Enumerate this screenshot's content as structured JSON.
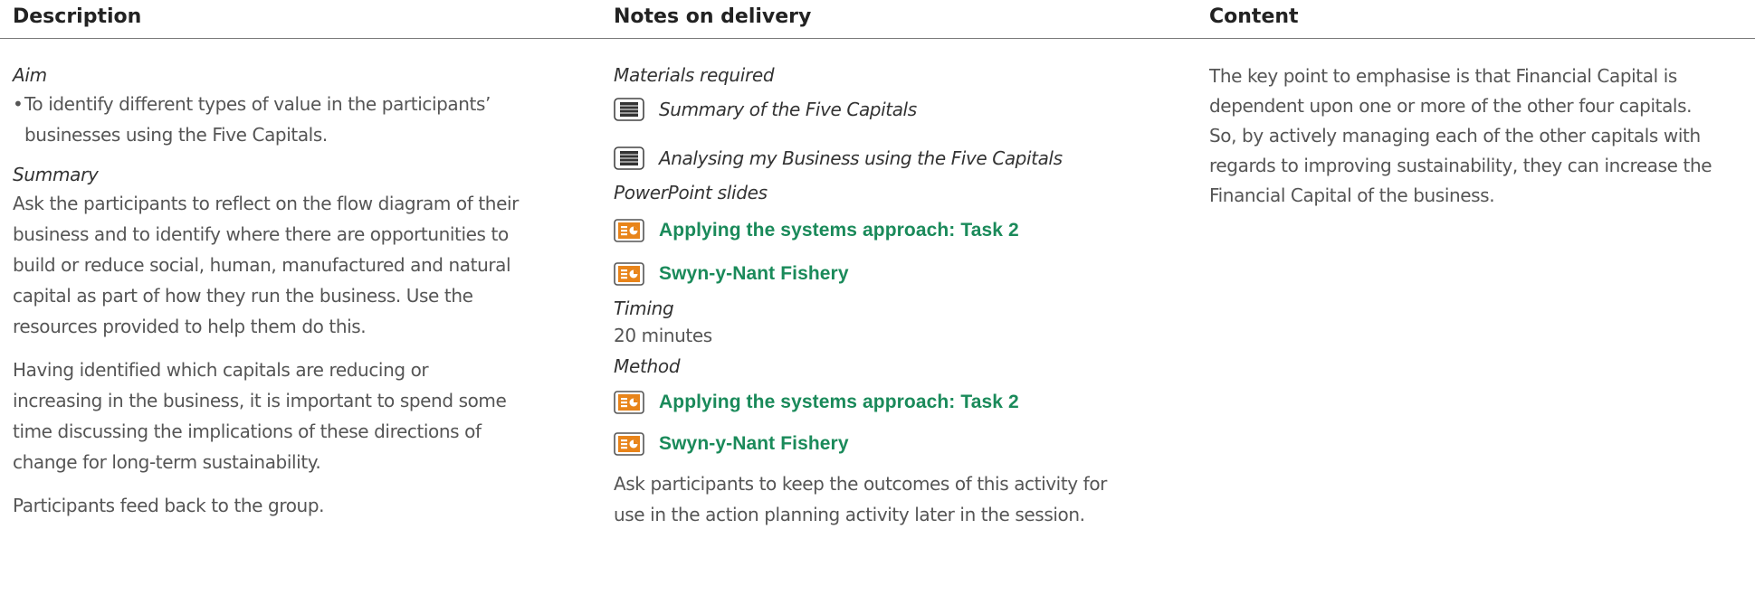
{
  "header": {
    "description": "Description",
    "notes": "Notes on delivery",
    "content": "Content"
  },
  "description": {
    "aim_label": "Aim",
    "aim_bullet_line1": "To identify different types of value in the participants’",
    "aim_bullet_line2": "businesses using the Five Capitals.",
    "summary_label": "Summary",
    "summary_p1": [
      "Ask the participants to reflect on the flow diagram of their",
      "business and to identify where there are opportunities to",
      "build or reduce social, human, manufactured and natural",
      "capital as part of how they run the business. Use the",
      "resources provided to help them do this."
    ],
    "summary_p2": [
      "Having identified which capitals are reducing or",
      "increasing in the business, it is important to spend some",
      "time discussing the implications of these directions of",
      "change for long-term sustainability."
    ],
    "summary_p3": "Participants feed back to the group."
  },
  "notes": {
    "materials_label": "Materials required",
    "materials": [
      {
        "icon": "document-icon",
        "title": "Summary of the Five Capitals"
      },
      {
        "icon": "document-icon",
        "title": "Analysing my Business using the Five Capitals"
      }
    ],
    "ppt_label": "PowerPoint slides",
    "ppt_slides": [
      {
        "icon": "powerpoint-icon",
        "title": "Applying the systems approach: Task 2"
      },
      {
        "icon": "powerpoint-icon",
        "title": "Swyn-y-Nant Fishery"
      }
    ],
    "timing_label": "Timing",
    "timing_value": "20 minutes",
    "method_label": "Method",
    "method_slides": [
      {
        "icon": "powerpoint-icon",
        "title": "Applying the systems approach: Task 2"
      },
      {
        "icon": "powerpoint-icon",
        "title": "Swyn-y-Nant Fishery"
      }
    ],
    "method_text": [
      "Ask participants to keep the outcomes of this activity for",
      "use in the action planning activity later in the session."
    ]
  },
  "content": {
    "text": [
      "The key point to emphasise is that Financial Capital is",
      "dependent upon one or more of the other four capitals.",
      "So, by actively managing each of the other capitals with",
      "regards to improving sustainability, they can increase the",
      "Financial Capital of the business."
    ]
  },
  "colors": {
    "ppt_green": "#1a8a5a",
    "ppt_icon_orange": "#e8841a",
    "rule_gray": "#7a7a7a"
  }
}
